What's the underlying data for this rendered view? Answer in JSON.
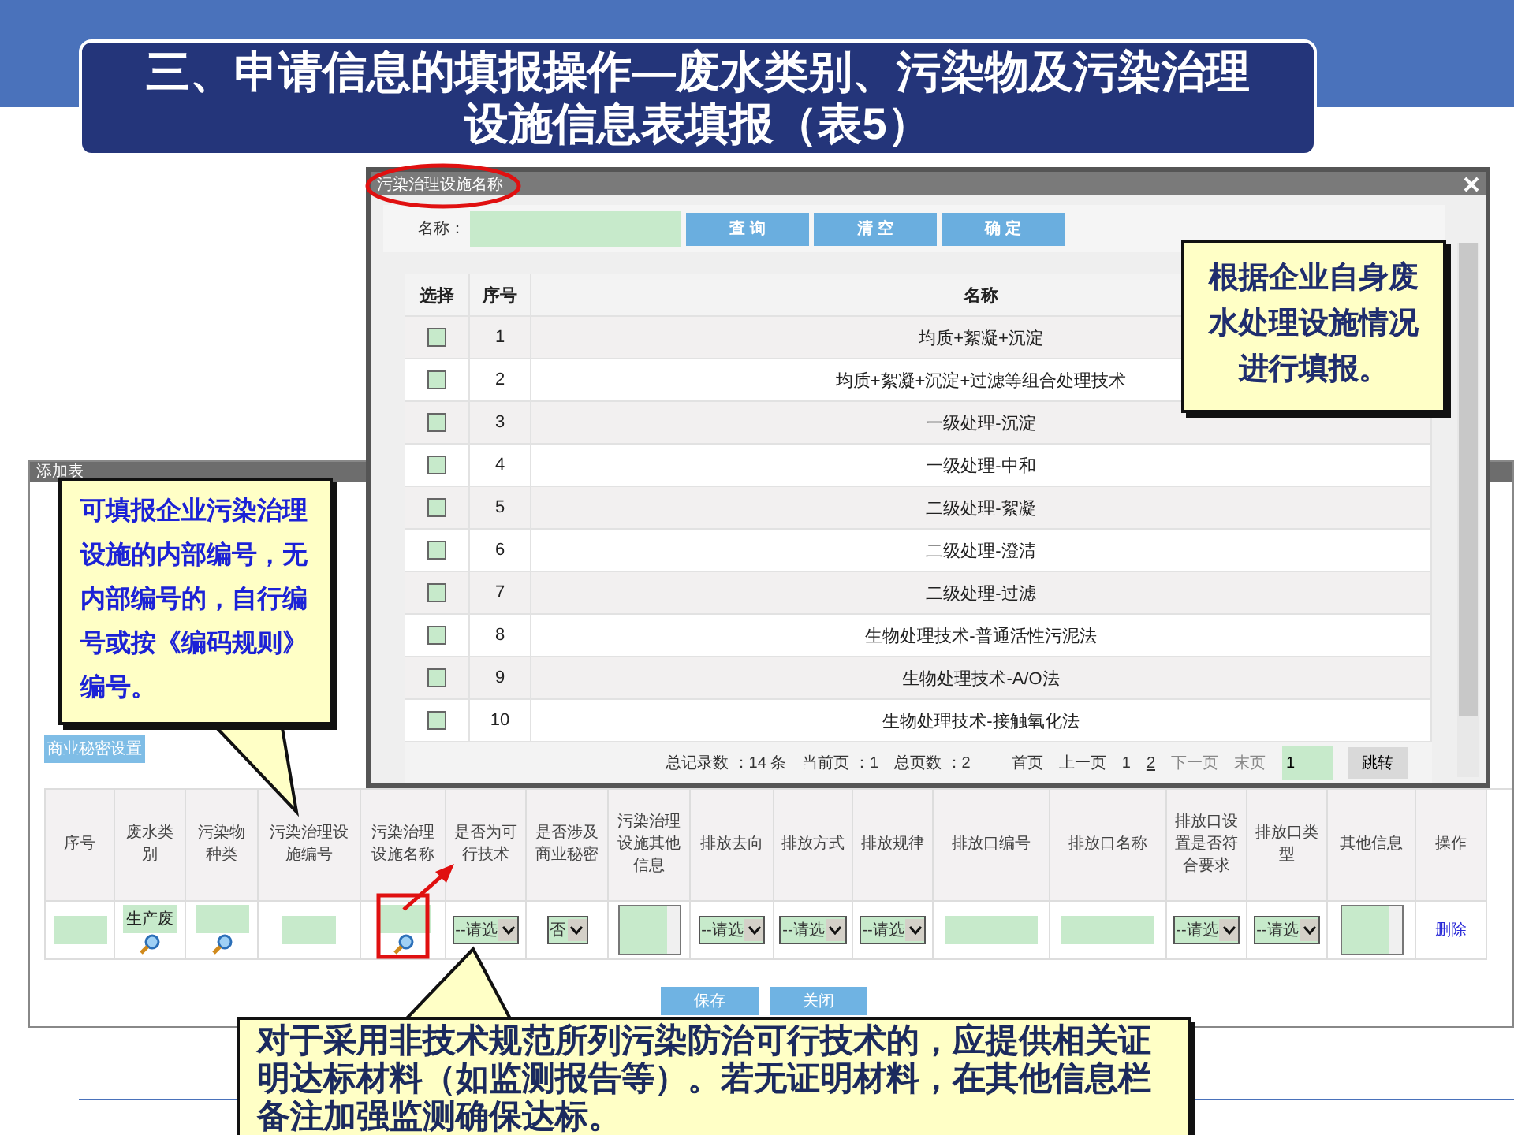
{
  "slide_title": "三、申请信息的填报操作—废水类别、污染物及污染治理设施信息表填报（表5）",
  "back_window": {
    "title": "添加表",
    "secret_button": "商业秘密设置",
    "columns": [
      "序号",
      "废水类别",
      "污染物种类",
      "污染治理设施编号",
      "污染治理设施名称",
      "是否为可行技术",
      "是否涉及商业秘密",
      "污染治理设施其他信息",
      "排放去向",
      "排放方式",
      "排放规律",
      "排放口编号",
      "排放口名称",
      "排放口设置是否符合要求",
      "排放口类型",
      "其他信息",
      "操作"
    ],
    "row": [
      {
        "kind": "field"
      },
      {
        "kind": "lookup",
        "value": "生产废"
      },
      {
        "kind": "lookup"
      },
      {
        "kind": "field"
      },
      {
        "kind": "lookup"
      },
      {
        "kind": "select",
        "value": "--请选"
      },
      {
        "kind": "select",
        "value": "否"
      },
      {
        "kind": "textarea"
      },
      {
        "kind": "select",
        "value": "--请选"
      },
      {
        "kind": "select",
        "value": "--请选"
      },
      {
        "kind": "select",
        "value": "--请选"
      },
      {
        "kind": "field"
      },
      {
        "kind": "field"
      },
      {
        "kind": "select",
        "value": "--请选"
      },
      {
        "kind": "select",
        "value": "--请选"
      },
      {
        "kind": "textarea"
      },
      {
        "kind": "link",
        "value": "删除"
      }
    ],
    "buttons": [
      "保存",
      "关闭"
    ]
  },
  "dialog": {
    "title": "污染治理设施名称",
    "search_label": "名称：",
    "buttons": [
      "查 询",
      "清 空",
      "确 定"
    ],
    "columns": [
      "选择",
      "序号",
      "名称"
    ],
    "rows": [
      {
        "index": "1",
        "name": "均质+絮凝+沉淀",
        "checked": false
      },
      {
        "index": "2",
        "name": "均质+絮凝+沉淀+过滤等组合处理技术",
        "checked": false
      },
      {
        "index": "3",
        "name": "一级处理-沉淀",
        "checked": false
      },
      {
        "index": "4",
        "name": "一级处理-中和",
        "checked": false
      },
      {
        "index": "5",
        "name": "二级处理-絮凝",
        "checked": false
      },
      {
        "index": "6",
        "name": "二级处理-澄清",
        "checked": false
      },
      {
        "index": "7",
        "name": "二级处理-过滤",
        "checked": false
      },
      {
        "index": "8",
        "name": "生物处理技术-普通活性污泥法",
        "checked": false
      },
      {
        "index": "9",
        "name": "生物处理技术-A/O法",
        "checked": false
      },
      {
        "index": "10",
        "name": "生物处理技术-接触氧化法",
        "checked": false
      }
    ],
    "pager": {
      "info": [
        "总记录数 ：14 条",
        "当前页 ：1",
        "总页数 ：2"
      ],
      "links": [
        {
          "label": "首页",
          "disabled": false
        },
        {
          "label": "上一页",
          "disabled": false
        },
        {
          "label": "1",
          "disabled": false
        },
        {
          "label": "2",
          "disabled": false
        },
        {
          "label": "下一页",
          "disabled": true
        },
        {
          "label": "末页",
          "disabled": true
        }
      ],
      "page_input": "1",
      "jump_button": "跳转"
    }
  },
  "callouts": [
    "根据企业自身废水处理设施情况进行填报。",
    "可填报企业污染治理设施的内部编号，无内部编号的，自行编号或按《编码规则》编号。",
    "对于采用非技术规范所列污染防治可行技术的，应提供相关证明达标材料（如监测报告等）。若无证明材料，在其他信息栏备注加强监测确保达标。"
  ]
}
